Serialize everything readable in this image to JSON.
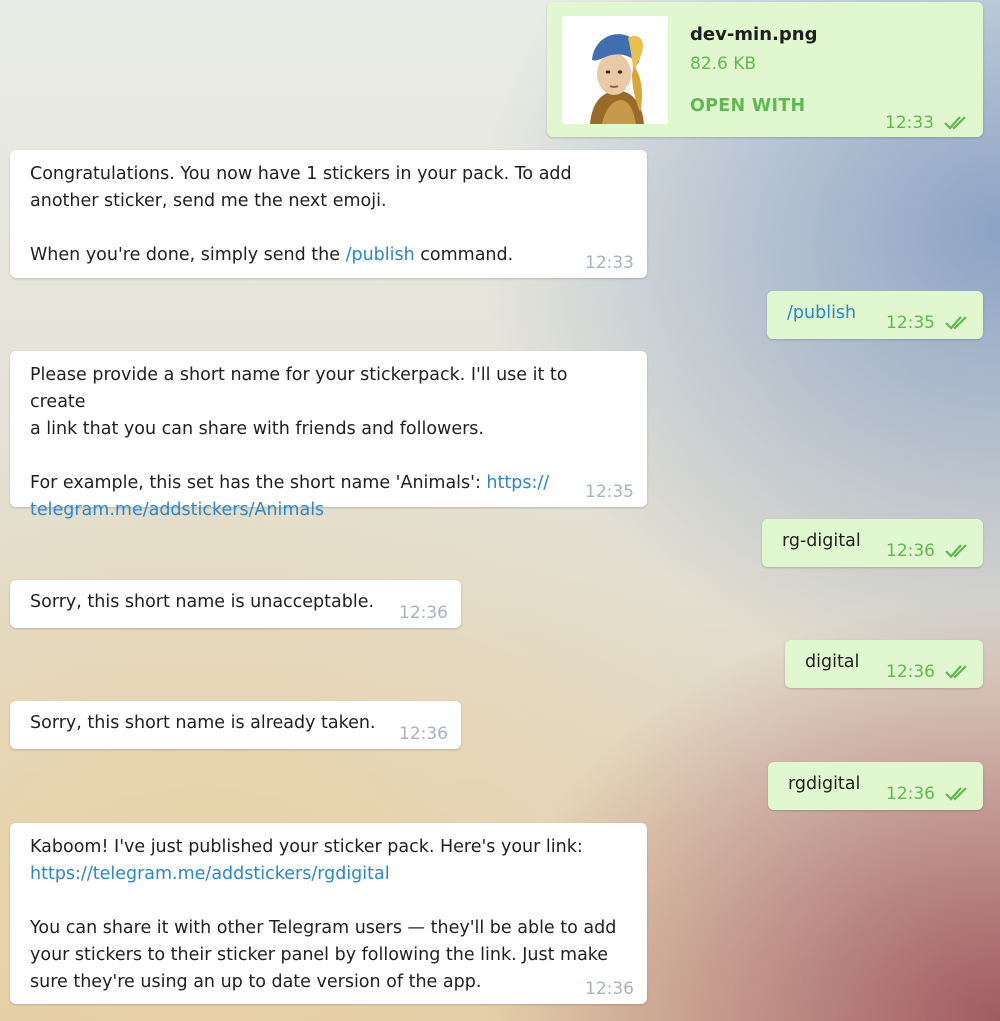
{
  "messages": [
    {
      "id": "m1",
      "direction": "out",
      "type": "file",
      "file_name": "dev-min.png",
      "file_size": "82.6 KB",
      "action": "OPEN WITH",
      "time": "12:33",
      "status_icon": "double-check-icon"
    },
    {
      "id": "m2",
      "direction": "in",
      "text": "Congratulations. You now have 1 stickers in your pack. To add\nanother sticker, send me the next emoji.\n\nWhen you're done, simply send the ",
      "link": "/publish",
      "text_after": " command.",
      "time": "12:33"
    },
    {
      "id": "m3",
      "direction": "out",
      "link": "/publish",
      "time": "12:35",
      "status_icon": "double-check-icon"
    },
    {
      "id": "m4",
      "direction": "in",
      "text": "Please provide a short name for your stickerpack. I'll use it to create\na link that you can share with friends and followers.\n\nFor example, this set has the short name 'Animals': ",
      "link": "https://\ntelegram.me/addstickers/Animals",
      "time": "12:35"
    },
    {
      "id": "m5",
      "direction": "out",
      "text": "rg-digital",
      "time": "12:36",
      "status_icon": "double-check-icon"
    },
    {
      "id": "m6",
      "direction": "in",
      "text": "Sorry, this short name is unacceptable.",
      "time": "12:36"
    },
    {
      "id": "m7",
      "direction": "out",
      "text": "digital",
      "time": "12:36",
      "status_icon": "double-check-icon"
    },
    {
      "id": "m8",
      "direction": "in",
      "text": "Sorry, this short name is already taken.",
      "time": "12:36"
    },
    {
      "id": "m9",
      "direction": "out",
      "text": "rgdigital",
      "time": "12:36",
      "status_icon": "double-check-icon"
    },
    {
      "id": "m10",
      "direction": "in",
      "text": "Kaboom! I've just published your sticker pack. Here's your link:\n",
      "link": "https://telegram.me/addstickers/rgdigital",
      "text_after": "\n\nYou can share it with other Telegram users — they'll be able to add\nyour stickers to their sticker panel by following the link. Just make\nsure they're using an up to date version of the app.",
      "time": "12:36"
    }
  ],
  "colors": {
    "outgoing_bubble": "#e1f7cf",
    "incoming_bubble": "#ffffff",
    "link": "#2a87c8",
    "outgoing_accent": "#5fb94f",
    "incoming_time": "#a9b3bd"
  }
}
